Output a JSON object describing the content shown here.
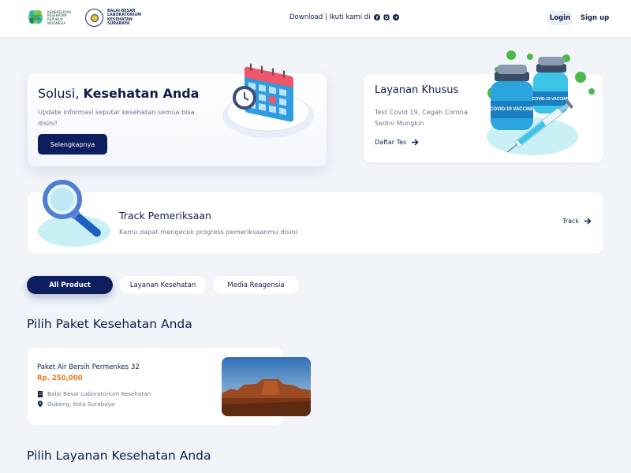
{
  "header": {
    "logo1_text": "KEMENTERIAN KESEHATAN REPUBLIK INDONESIA",
    "logo2_text": "BALAI BESAR LABORATORIUM KESEHATAN SURABAYA",
    "center_text": "Download | Ikuti kami di",
    "social_icons": [
      "facebook-icon",
      "instagram-icon",
      "telegram-icon"
    ],
    "login_label": "Login",
    "signup_label": "Sign up"
  },
  "hero": {
    "title_prefix": "Solusi,",
    "title_bold": "Kesehatan Anda",
    "description": "Update informasi seputar kesehatan semua bisa disini!",
    "button_label": "Selengkapnya"
  },
  "special": {
    "title": "Layanan Khusus",
    "description": "Test Covid 19, Cegah Corona Sedini Mungkin",
    "link_label": "Daftar Tes",
    "vaccine_label_1": "COVID-19 VACCINE",
    "vaccine_label_2": "COVID-19 VACCINE"
  },
  "track": {
    "title": "Track Pemeriksaan",
    "description": "Kamu dapat mengecek progress pemeriksaanmu disini",
    "link_label": "Track"
  },
  "tabs": [
    {
      "label": "All Product",
      "active": true
    },
    {
      "label": "Layanan Kesehatan",
      "active": false
    },
    {
      "label": "Media Reagensia",
      "active": false
    }
  ],
  "section1_title": "Pilih Paket Kesehatan Anda",
  "product": {
    "name": "Paket Air Bersih Permenkes 32",
    "price": "Rp. 250,000",
    "lab": "Balai Besar Laboratorium Kesehatan",
    "location": "Gubeng, Kota Surabaya"
  },
  "section2_title": "Pilih Layanan Kesehatan Anda",
  "colors": {
    "primary": "#0c1e5e",
    "price": "#f07a1a",
    "background": "#f1f4f9"
  }
}
